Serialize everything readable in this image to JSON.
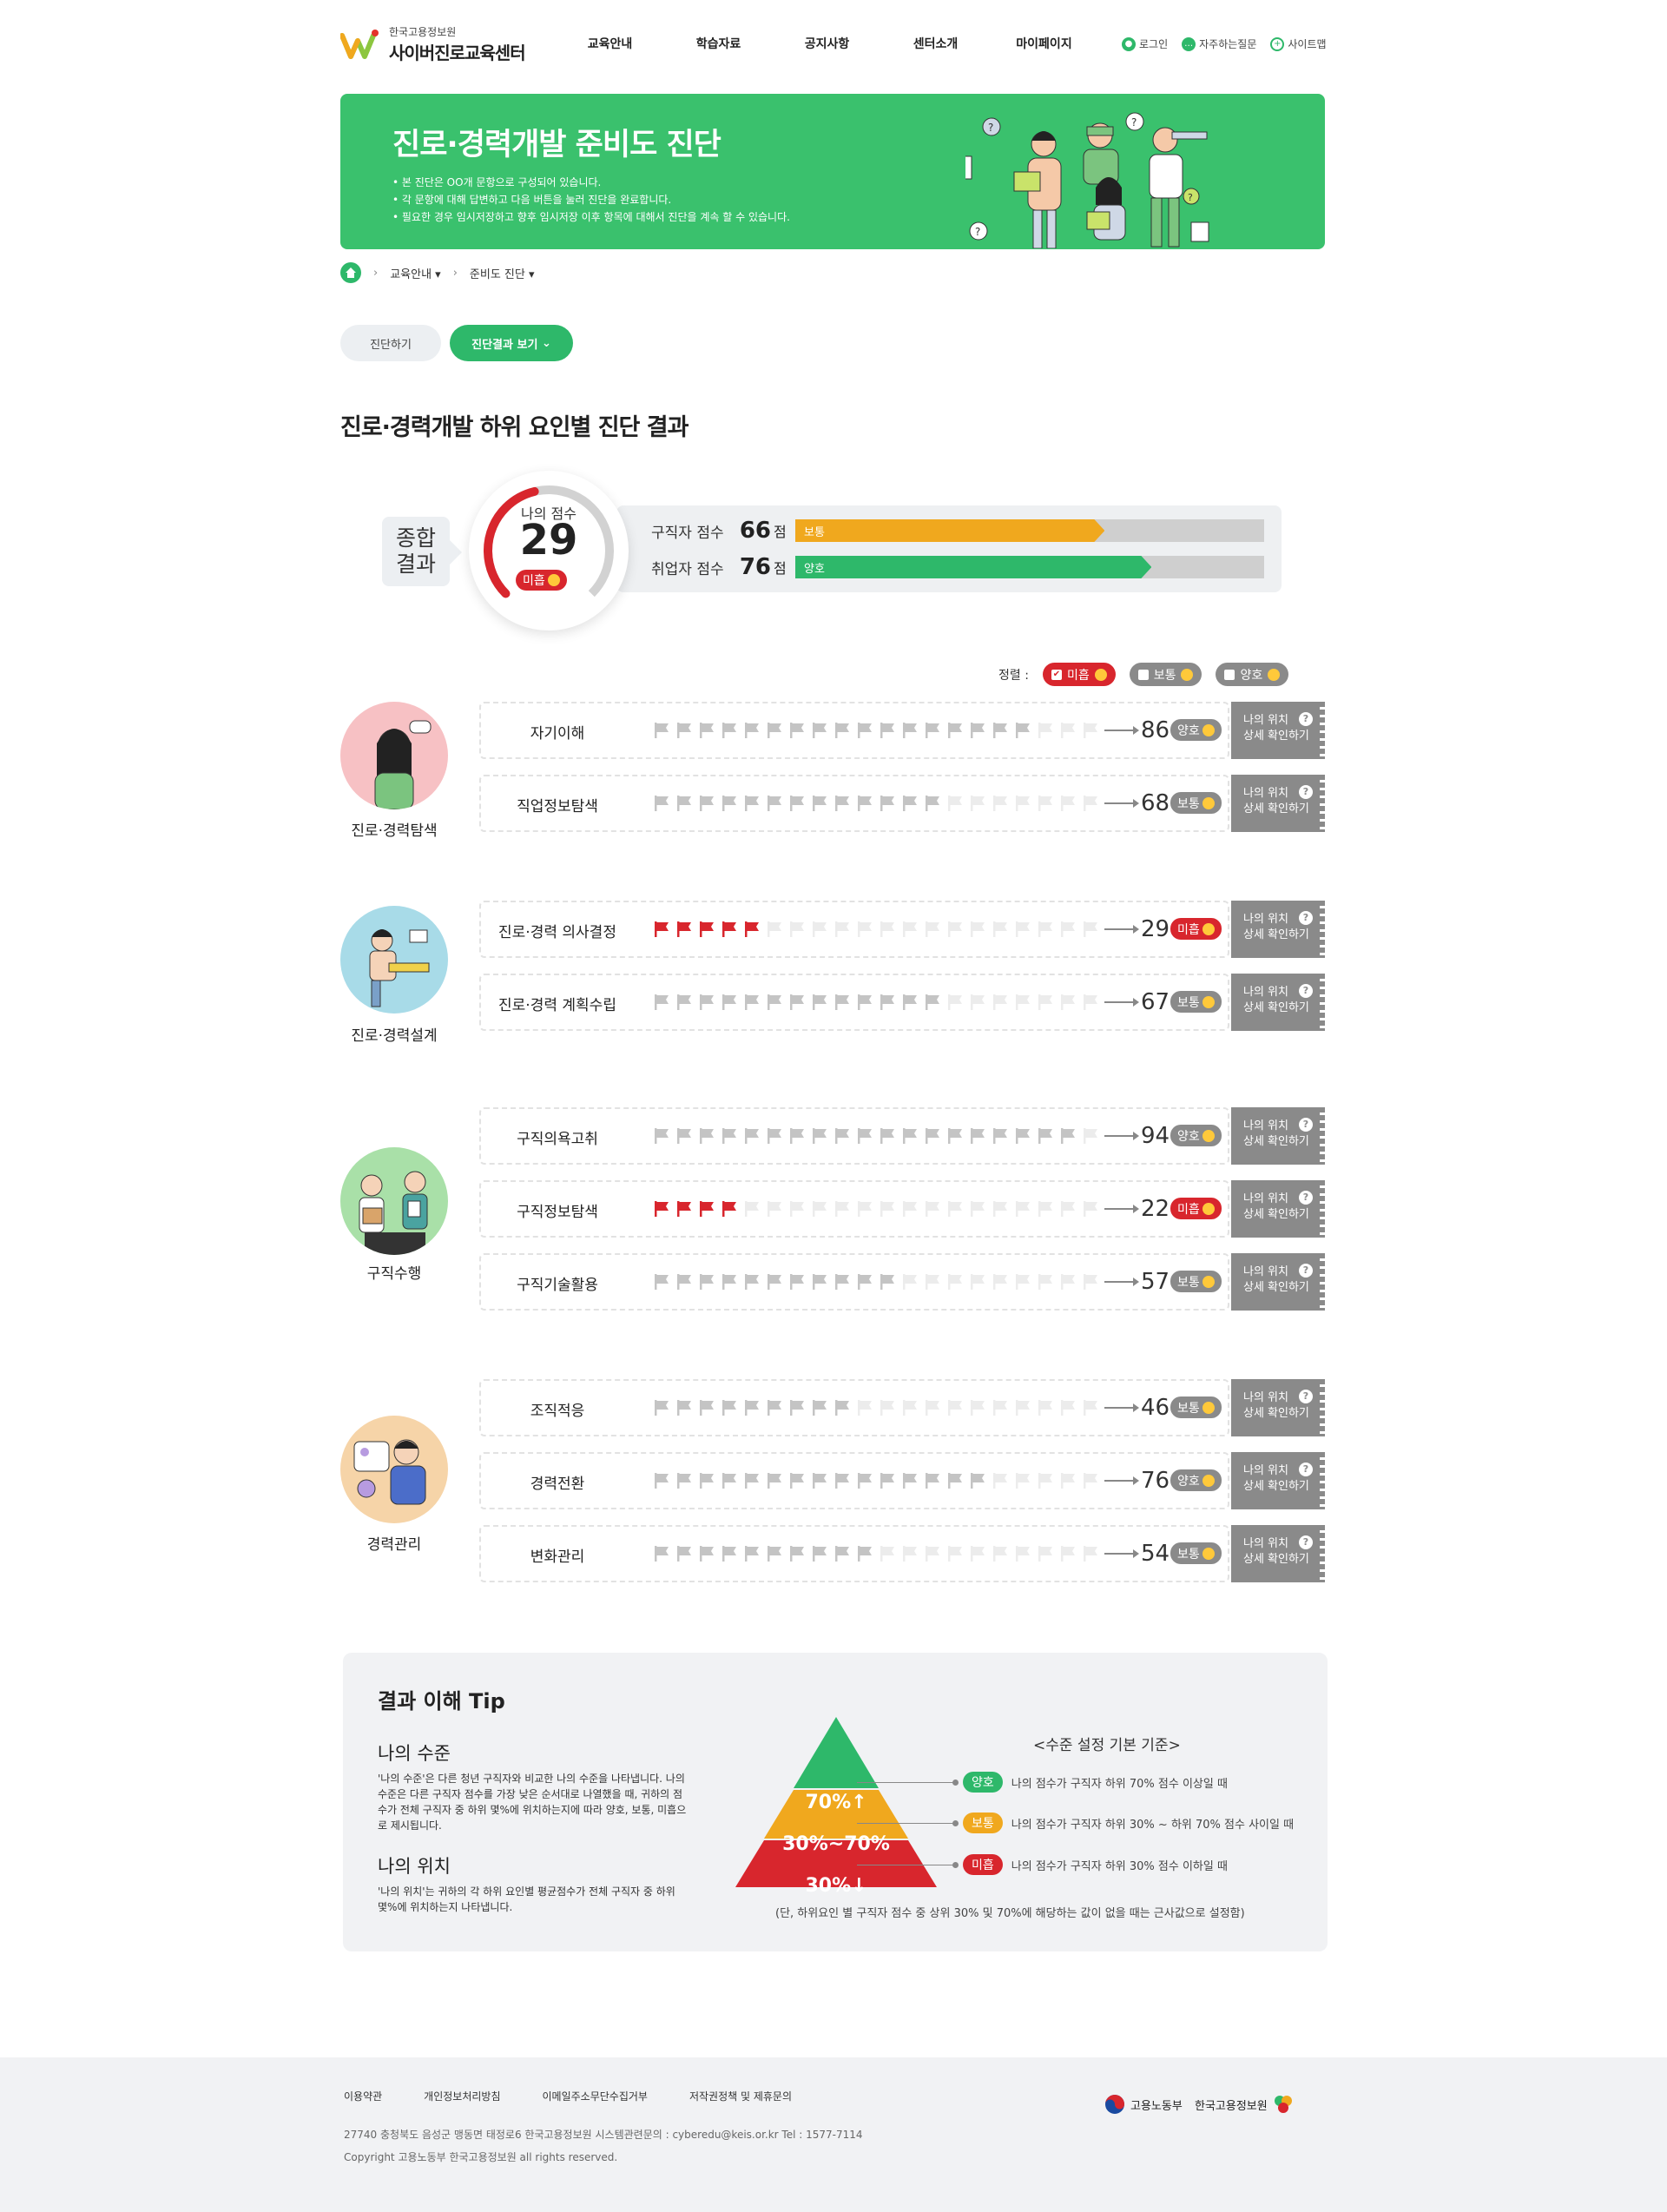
{
  "header": {
    "org_small": "한국고용정보원",
    "site_name": "사이버진로교육센터",
    "nav": [
      "교육안내",
      "학습자료",
      "공지사항",
      "센터소개",
      "마이페이지"
    ],
    "util": {
      "login": "로그인",
      "faq": "자주하는질문",
      "sitemap": "사이트맵"
    }
  },
  "banner": {
    "title": "진로·경력개발 준비도 진단",
    "bullets": [
      "• 본 진단은 OO개 문항으로 구성되어 있습니다.",
      "• 각 문항에 대해 답변하고 다음 버튼을 눌러 진단을 완료합니다.",
      "• 필요한 경우 임시저장하고 향후 임시저장 이후 항목에 대해서 진단을 계속 할 수 있습니다."
    ]
  },
  "breadcrumb": {
    "level1": "교육안내",
    "level2": "준비도 진단"
  },
  "tabs": {
    "diagnose": "진단하기",
    "result": "진단결과 보기"
  },
  "section_title": "진로·경력개발 하위 요인별 진단 결과",
  "summary": {
    "label_line1": "종합",
    "label_line2": "결과",
    "my_score_label": "나의 점수",
    "my_score": "29",
    "my_level": "미흡",
    "my_score_fraction": 0.29,
    "bars": [
      {
        "label": "구직자 점수",
        "score": "66",
        "unit": "점",
        "level": "보통",
        "fraction": 0.66,
        "color": "#f0a81e"
      },
      {
        "label": "취업자 점수",
        "score": "76",
        "unit": "점",
        "level": "양호",
        "fraction": 0.76,
        "color": "#2eb86a"
      }
    ]
  },
  "sort": {
    "label": "정렬 :",
    "options": [
      {
        "label": "미흡",
        "checked": true,
        "color": "#d8262d"
      },
      {
        "label": "보통",
        "checked": false,
        "color": "#8a8a8a"
      },
      {
        "label": "양호",
        "checked": false,
        "color": "#8a8a8a"
      }
    ]
  },
  "position_button": {
    "line1": "나의 위치",
    "line2": "상세 확인하기"
  },
  "groups": [
    {
      "name": "진로·경력탐색",
      "items": [
        {
          "name": "자기이해",
          "score": "86",
          "level": "양호",
          "flags": 17
        },
        {
          "name": "직업정보탐색",
          "score": "68",
          "level": "보통",
          "flags": 13
        }
      ]
    },
    {
      "name": "진로·경력설계",
      "items": [
        {
          "name": "진로·경력 의사결정",
          "score": "29",
          "level": "미흡",
          "flags": 5
        },
        {
          "name": "진로·경력 계획수립",
          "score": "67",
          "level": "보통",
          "flags": 13
        }
      ]
    },
    {
      "name": "구직수행",
      "items": [
        {
          "name": "구직의욕고취",
          "score": "94",
          "level": "양호",
          "flags": 19
        },
        {
          "name": "구직정보탐색",
          "score": "22",
          "level": "미흡",
          "flags": 4
        },
        {
          "name": "구직기술활용",
          "score": "57",
          "level": "보통",
          "flags": 11
        }
      ]
    },
    {
      "name": "경력관리",
      "items": [
        {
          "name": "조직적응",
          "score": "46",
          "level": "보통",
          "flags": 9
        },
        {
          "name": "경력전환",
          "score": "76",
          "level": "양호",
          "flags": 15
        },
        {
          "name": "변화관리",
          "score": "54",
          "level": "보통",
          "flags": 10
        }
      ]
    }
  ],
  "tip": {
    "title": "결과 이해 Tip",
    "level_heading": "나의 수준",
    "level_text": "'나의 수준'은 다른 청년 구직자와 비교한 나의 수준을 나타냅니다. 나의 수준은 다른 구직자 점수를 가장 낮은 순서대로 나열했을 때, 귀하의 점수가 전체 구직자 중 하위 몇%에 위치하는지에 따라 양호, 보통, 미흡으로 제시됩니다.",
    "position_heading": "나의 위치",
    "position_text": "'나의 위치'는 귀하의 각 하위 요인별 평균점수가 전체 구직자 중 하위 몇%에 위치하는지 나타냅니다.",
    "pyramid": [
      "70%↑",
      "30%~70%",
      "30%↓"
    ],
    "criteria_title": "<수준 설정 기본 기준>",
    "criteria": [
      {
        "badge": "양호",
        "text": "나의 점수가 구직자 하위 70% 점수 이상일 때",
        "color": "#2eb86a"
      },
      {
        "badge": "보통",
        "text": "나의 점수가 구직자 하위 30% ~ 하위 70% 점수 사이일 때",
        "color": "#f0a81e"
      },
      {
        "badge": "미흡",
        "text": "나의 점수가 구직자 하위 30% 점수 이하일 때",
        "color": "#d8262d"
      }
    ],
    "note": "(단, 하위요인 별 구직자 점수 중 상위 30% 및 70%에 해당하는 값이 없을 때는 근사값으로 설정함)"
  },
  "footer": {
    "links": [
      "이용약관",
      "개인정보처리방침",
      "이메일주소무단수집거부",
      "저작권정책 및 제휴문의"
    ],
    "address": "27740 충청북도 음성군 맹동면 태정로6 한국고용정보원    시스템관련문의 : cyberedu@keis.or.kr    Tel : 1577-7114",
    "copyright": "Copyright 고용노동부 한국고용정보원 all rights reserved.",
    "logo1": "고용노동부",
    "logo2": "한국고용정보원"
  },
  "colors": {
    "brand": "#3ac16d",
    "good": "#2eb86a",
    "normal": "#f0a81e",
    "poor": "#d8262d",
    "neutral": "#8a8a8a"
  }
}
